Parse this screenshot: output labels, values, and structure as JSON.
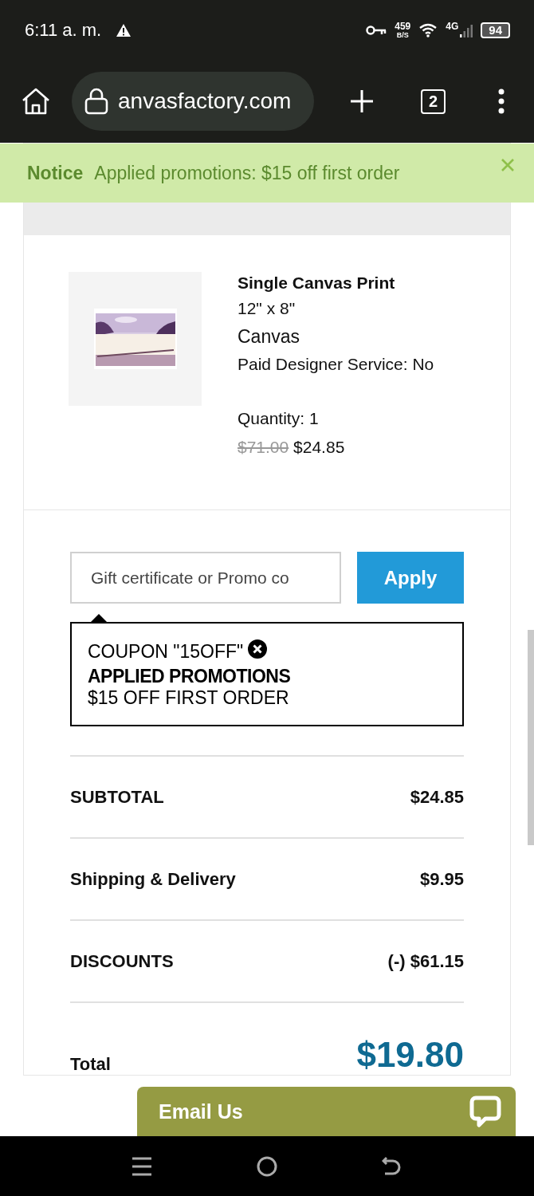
{
  "status_bar": {
    "time": "6:11 a. m.",
    "net_speed": "459",
    "net_unit": "B/S",
    "network": "4G",
    "battery": "94"
  },
  "browser": {
    "url": "anvasfactory.com",
    "tab_count": "2"
  },
  "notice": {
    "label": "Notice",
    "message": "Applied promotions: $15 off first order"
  },
  "item": {
    "name": "Single Canvas Print",
    "size": "12\" x 8\"",
    "material": "Canvas",
    "service": "Paid Designer Service:  No",
    "quantity": "Quantity: 1",
    "old_price": "$71.00",
    "price": "$24.85"
  },
  "promo": {
    "placeholder": "Gift certificate or Promo co",
    "button": "Apply"
  },
  "coupon": {
    "code": "COUPON \"15OFF\"",
    "heading": "APPLIED PROMOTIONS",
    "description": "$15 OFF FIRST ORDER"
  },
  "totals": [
    {
      "label": "SUBTOTAL",
      "value": "$24.85"
    },
    {
      "label": "Shipping & Delivery",
      "value": "$9.95"
    },
    {
      "label": "DISCOUNTS",
      "value": "(-) $61.15"
    }
  ],
  "total": {
    "label": "Total",
    "value": "$19.80"
  },
  "email": {
    "label": "Email Us"
  }
}
